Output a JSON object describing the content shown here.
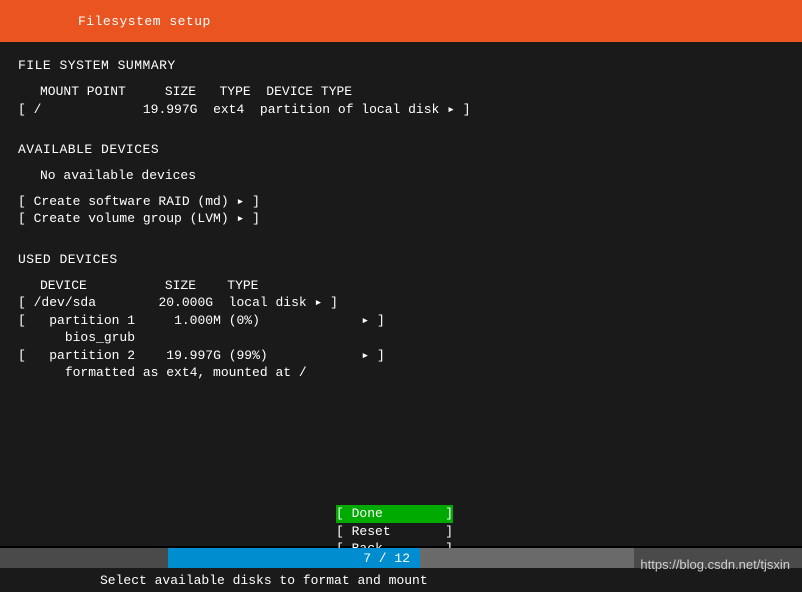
{
  "header": {
    "title": "Filesystem setup"
  },
  "summary": {
    "title": "FILE SYSTEM SUMMARY",
    "columns": {
      "mount": "MOUNT POINT",
      "size": "SIZE",
      "type": "TYPE",
      "dtype": "DEVICE TYPE"
    },
    "rows": [
      {
        "mount": "/",
        "size": "19.997G",
        "type": "ext4",
        "dtype": "partition of local disk"
      }
    ]
  },
  "available": {
    "title": "AVAILABLE DEVICES",
    "empty_text": "No available devices",
    "actions": [
      {
        "label": "Create software RAID (md)"
      },
      {
        "label": "Create volume group (LVM)"
      }
    ]
  },
  "used": {
    "title": "USED DEVICES",
    "columns": {
      "device": "DEVICE",
      "size": "SIZE",
      "type": "TYPE"
    },
    "disk": {
      "name": "/dev/sda",
      "size": "20.000G",
      "type": "local disk"
    },
    "partitions": [
      {
        "name": "partition 1",
        "size": "1.000M",
        "pct": "(0%)",
        "detail": "bios_grub"
      },
      {
        "name": "partition 2",
        "size": "19.997G",
        "pct": "(99%)",
        "detail": "formatted as ext4, mounted at /"
      }
    ]
  },
  "buttons": {
    "done": "Done",
    "reset": "Reset",
    "back": "Back"
  },
  "progress": {
    "current": "7",
    "total": "12",
    "text": "7 / 12"
  },
  "hint": "Select available disks to format and mount",
  "watermark": "https://blog.csdn.net/tjsxin",
  "glyph": {
    "arrow": "▸"
  }
}
